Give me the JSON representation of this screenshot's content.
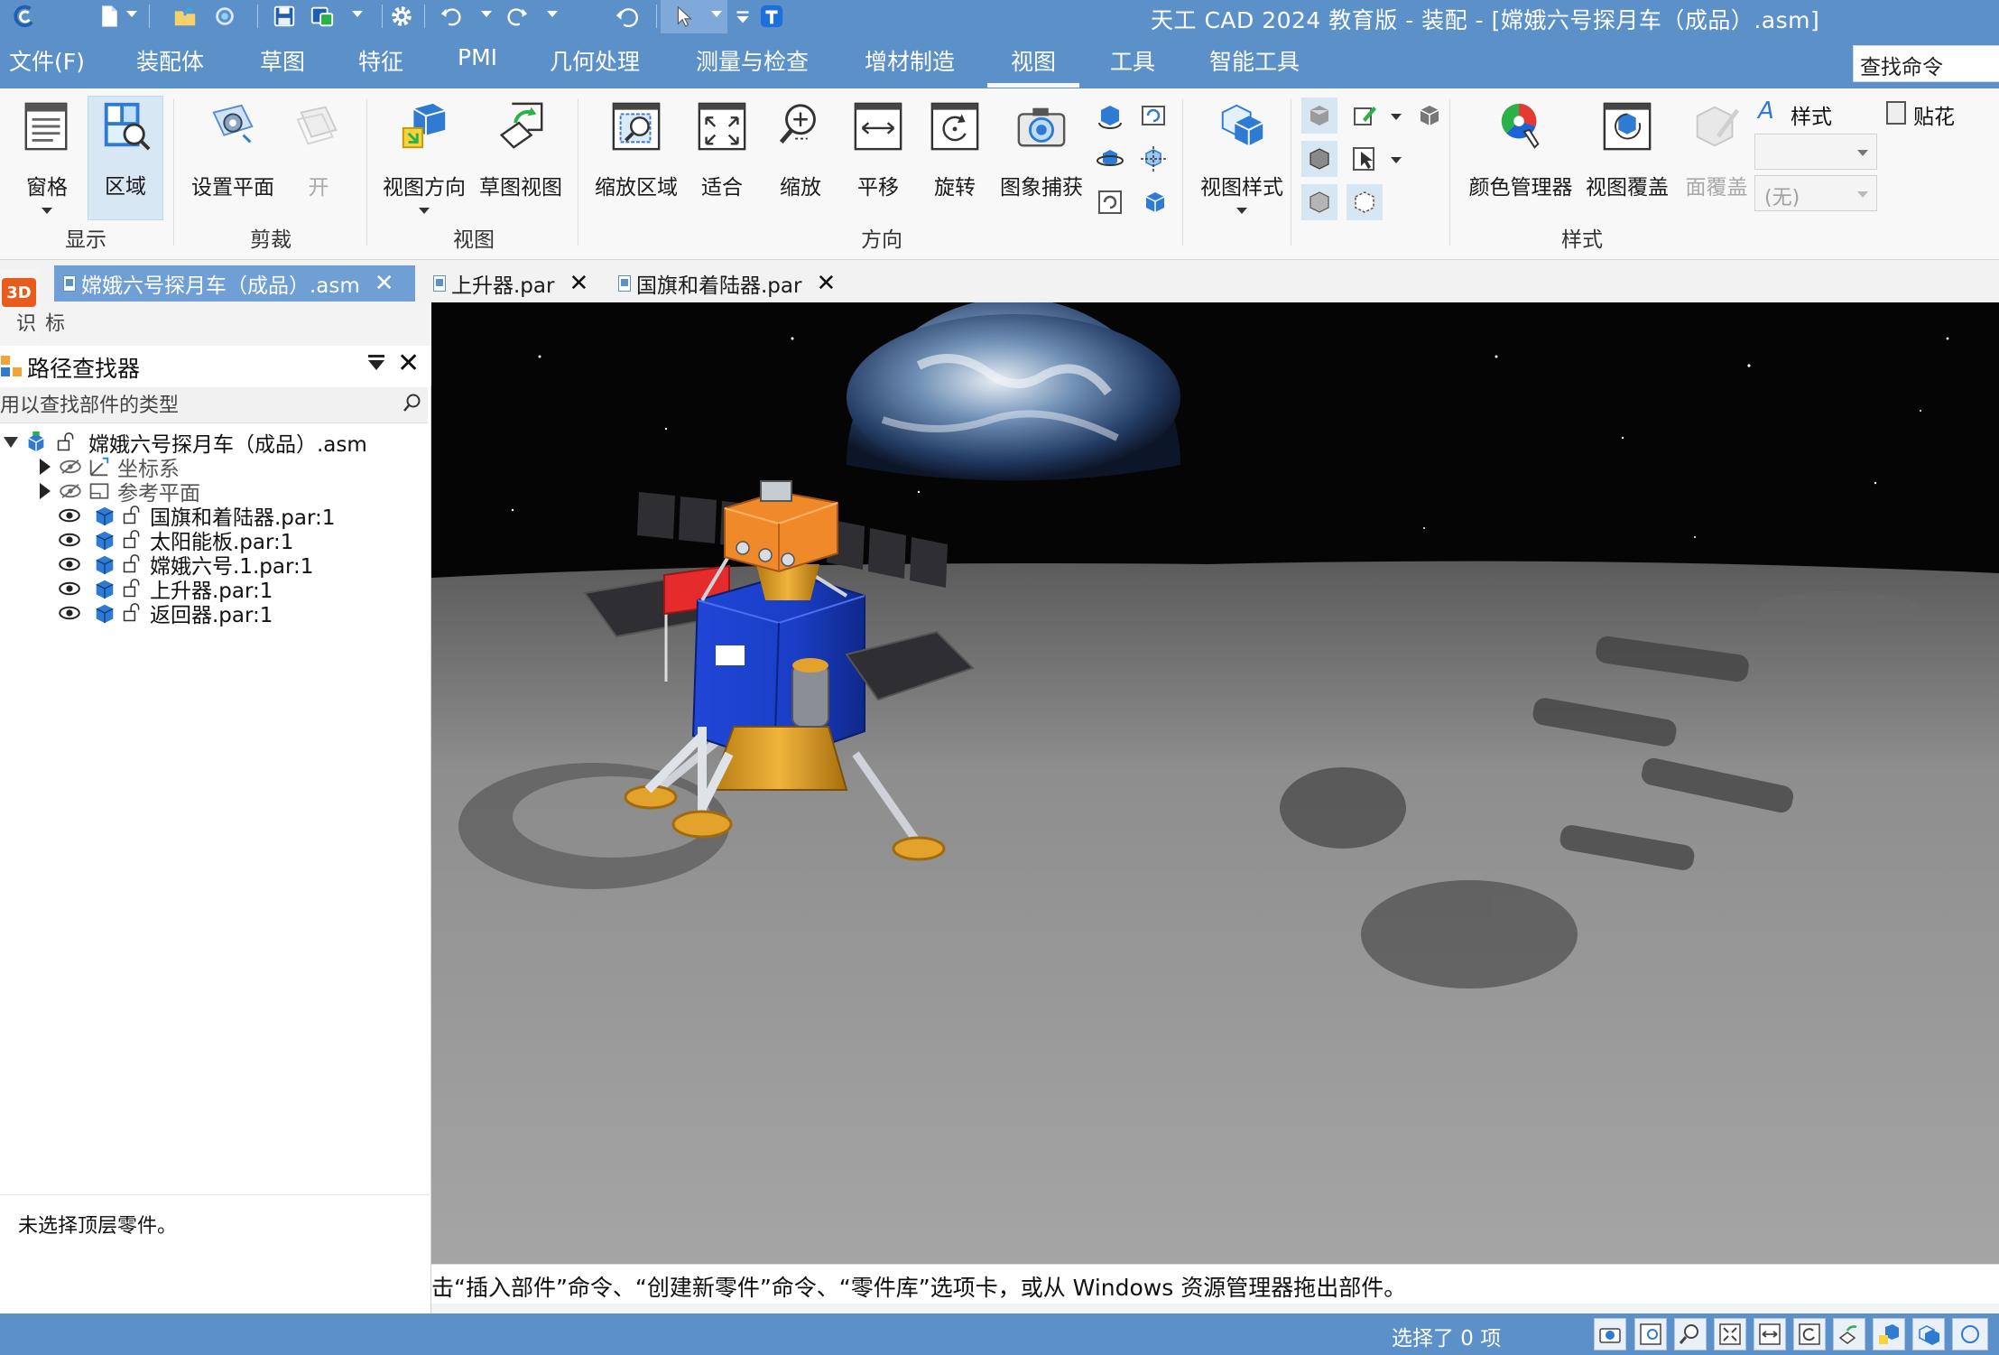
{
  "window": {
    "title": "天工 CAD 2024 教育版 - 装配 - [嫦娥六号探月车（成品）.asm]"
  },
  "quick_access": {
    "icons": [
      "app-logo-icon",
      "new-file-icon",
      "open-file-icon",
      "sync-icon",
      "save-icon",
      "save-as-icon",
      "settings-gear-icon",
      "undo-icon",
      "redo-icon",
      "undo-history-icon",
      "select-pointer-icon",
      "customize-qat-icon",
      "t-logo-icon"
    ]
  },
  "menu": {
    "items": [
      "文件(F)",
      "装配体",
      "草图",
      "特征",
      "PMI",
      "几何处理",
      "测量与检查",
      "增材制造",
      "视图",
      "工具",
      "智能工具"
    ],
    "active": "视图",
    "find_command": "查找命令"
  },
  "ribbon": {
    "groups": {
      "display": {
        "label": "显示",
        "buttons": [
          {
            "label": "窗格",
            "icon": "pane-icon"
          },
          {
            "label": "区域",
            "icon": "zone-icon"
          }
        ]
      },
      "clip": {
        "label": "剪裁",
        "buttons": [
          {
            "label": "设置平面",
            "icon": "set-plane-icon"
          },
          {
            "label": "开",
            "icon": "clip-on-icon"
          }
        ]
      },
      "views": {
        "label": "视图",
        "buttons": [
          {
            "label": "视图方向",
            "icon": "view-orientation-icon"
          },
          {
            "label": "草图视图",
            "icon": "sketch-view-icon"
          }
        ]
      },
      "orient": {
        "label": "方向",
        "buttons": [
          {
            "label": "缩放区域",
            "icon": "zoom-area-icon"
          },
          {
            "label": "适合",
            "icon": "fit-icon"
          },
          {
            "label": "缩放",
            "icon": "zoom-icon"
          },
          {
            "label": "平移",
            "icon": "pan-icon"
          },
          {
            "label": "旋转",
            "icon": "rotate-icon"
          },
          {
            "label": "图象捕获",
            "icon": "camera-icon"
          }
        ]
      },
      "view_styles": {
        "buttons": [
          {
            "label": "视图样式",
            "icon": "view-style-icon"
          }
        ]
      },
      "style": {
        "label": "样式",
        "buttons": [
          {
            "label": "颜色管理器",
            "icon": "color-manager-icon"
          },
          {
            "label": "视图覆盖",
            "icon": "view-override-icon"
          },
          {
            "label": "面覆盖",
            "icon": "face-override-icon"
          }
        ],
        "style_label": "样式",
        "decal_label": "贴花",
        "style_combo_value": "",
        "none_combo_value": "(无)"
      }
    }
  },
  "tabs": [
    {
      "label": "嫦娥六号探月车（成品）.asm",
      "active": true
    },
    {
      "label": "上升器.par",
      "active": false
    },
    {
      "label": "国旗和着陆器.par",
      "active": false
    }
  ],
  "side_strip": {
    "badge": "3D",
    "label": "标识"
  },
  "pathfinder": {
    "title": "路径查找器",
    "search_placeholder": "用以查找部件的类型",
    "root": "嫦娥六号探月车（成品）.asm",
    "folders": [
      "坐标系",
      "参考平面"
    ],
    "parts": [
      "国旗和着陆器.par:1",
      "太阳能板.par:1",
      "嫦娥六号.1.par:1",
      "上升器.par:1",
      "返回器.par:1"
    ],
    "status": "未选择顶层零件。"
  },
  "prompt": {
    "text": "击“插入部件”命令、“创建新零件”命令、“零件库”选项卡，或从 Windows 资源管理器拖出部件。"
  },
  "statusbar": {
    "selection": "选择了 0 项",
    "icons": [
      "image-capture-icon",
      "zoom-area-icon",
      "zoom-icon",
      "fit-icon",
      "pan-icon",
      "rotate-icon",
      "sketch-view-icon",
      "view-orientation-icon",
      "view-style-icon",
      "more-icon"
    ]
  },
  "colors": {
    "titlebar": "#5c90c9",
    "active_tab": "#6f9fd4",
    "selected_button": "#d7e7f4",
    "lander_blue": "#1b3fc9",
    "ascender_orange": "#f0892a",
    "leg_gold": "#e2a22b",
    "solar_panel": "#2f2f33",
    "flag_red": "#e52b2b"
  }
}
